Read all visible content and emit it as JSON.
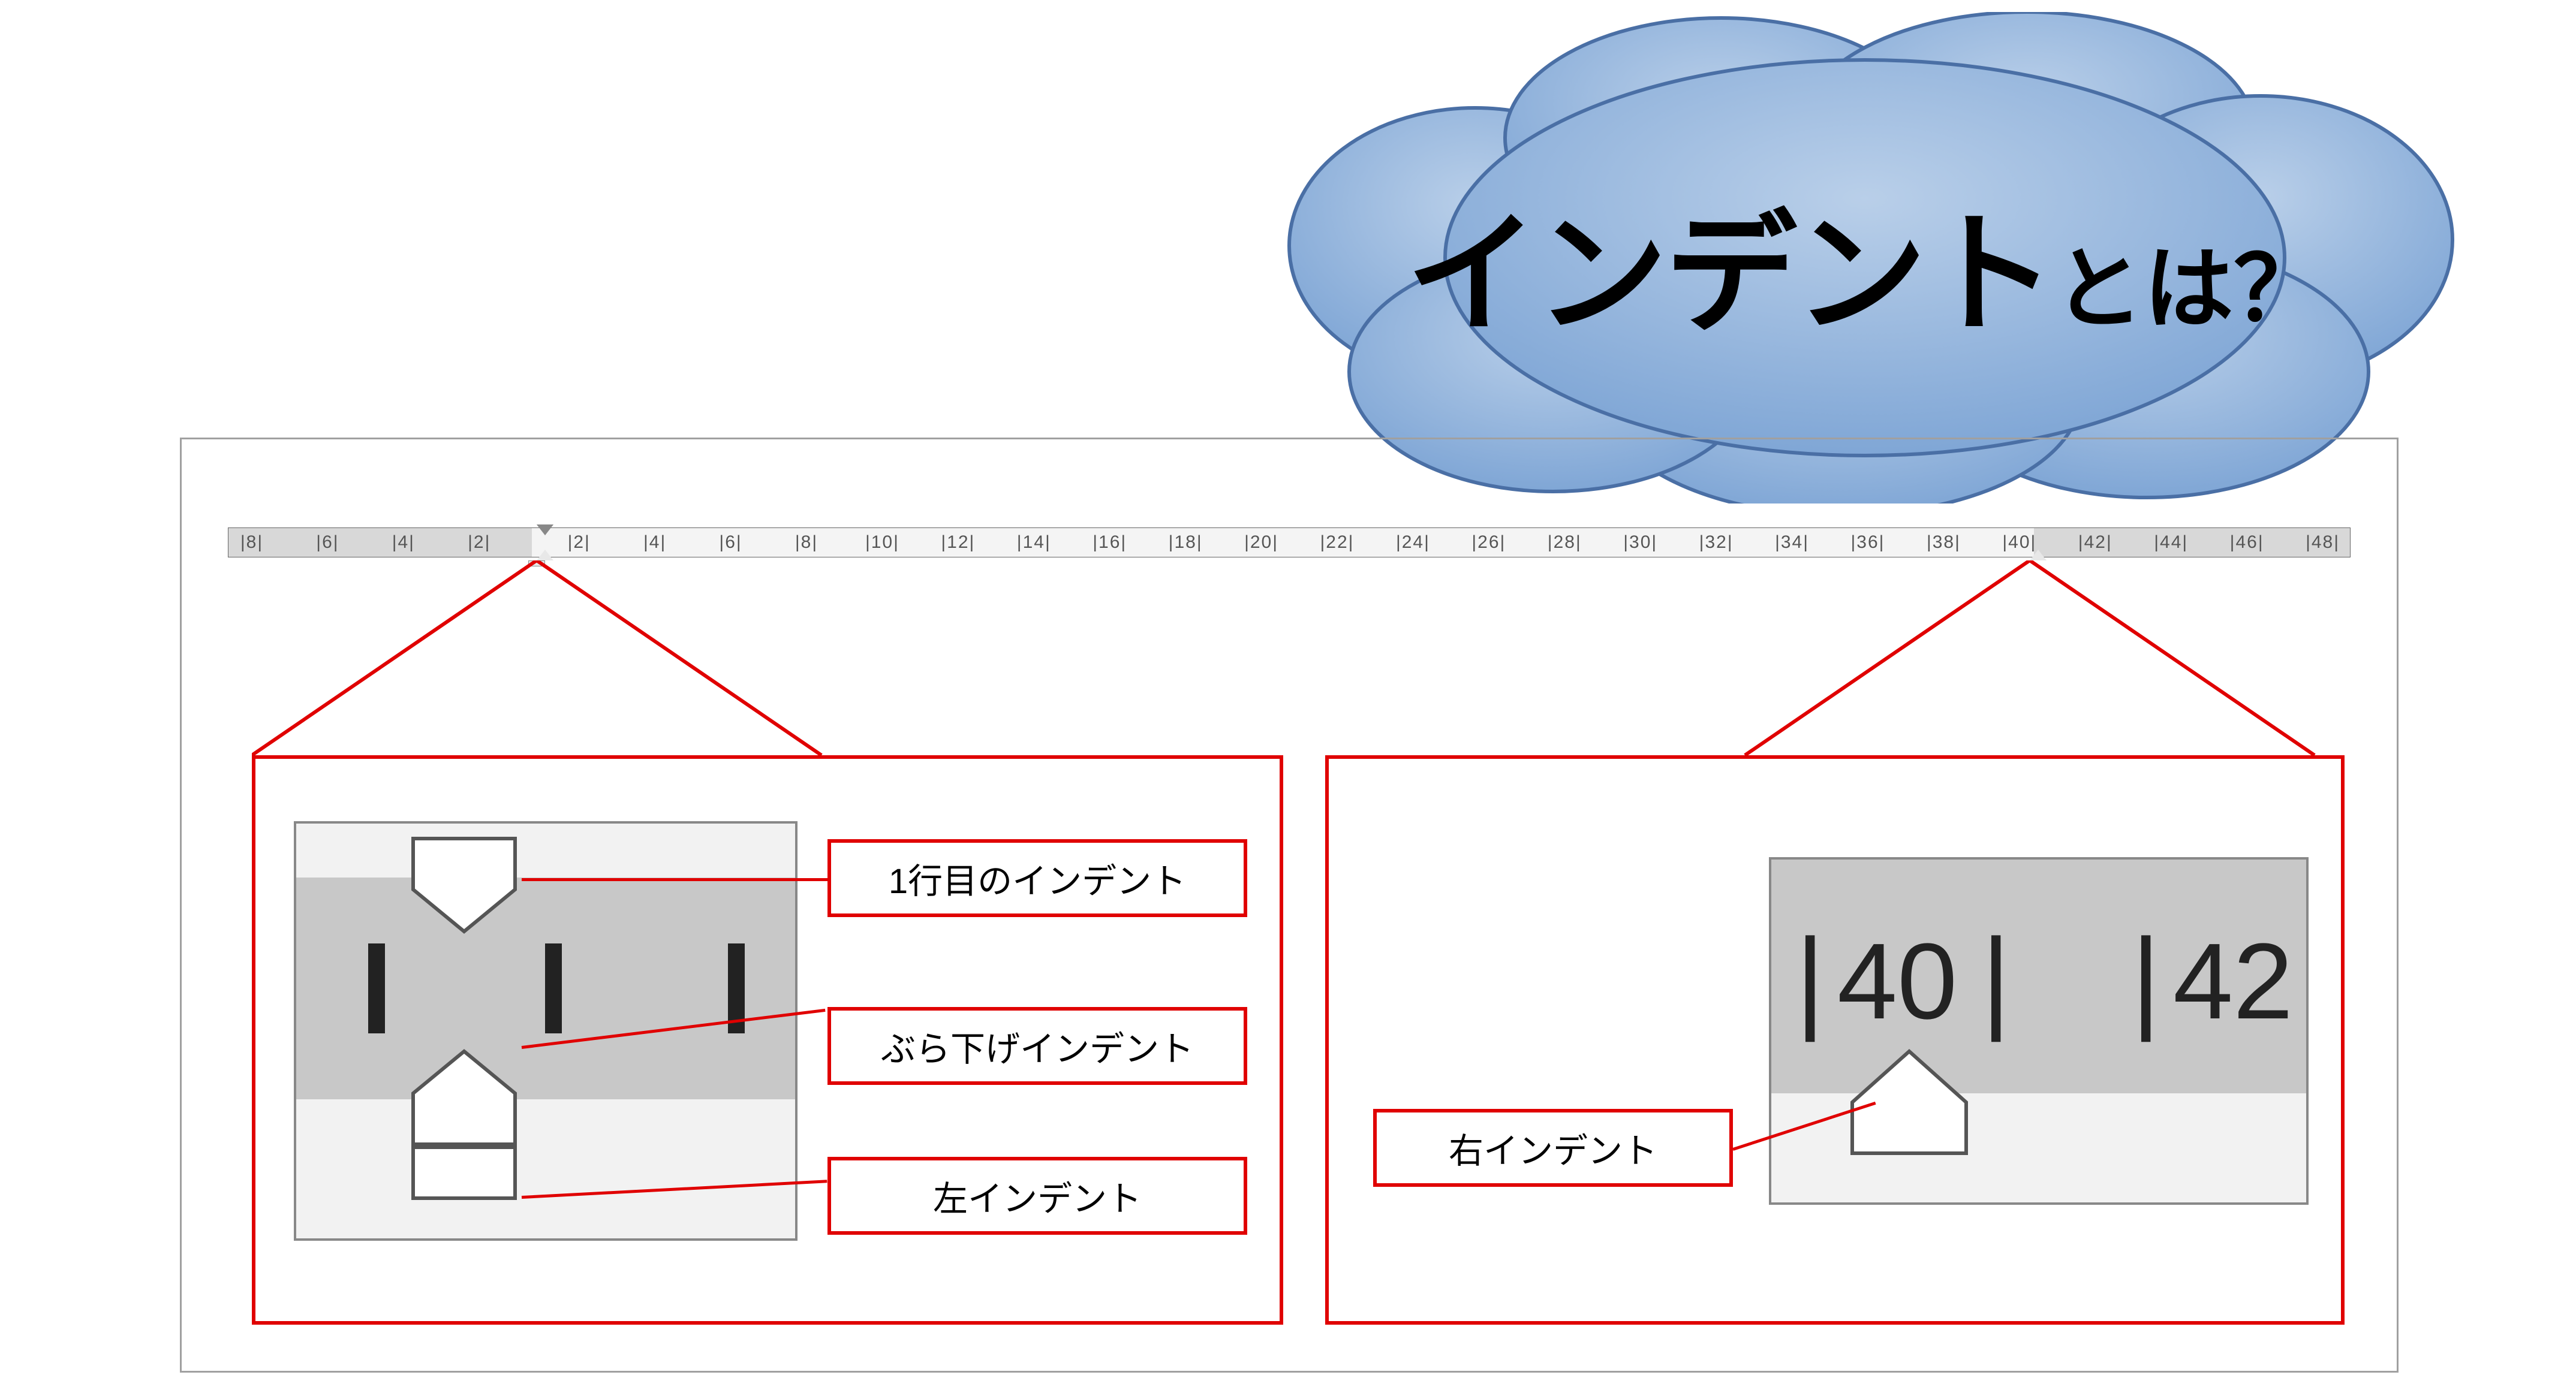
{
  "title": {
    "bold": "インデント",
    "tail": "とは？"
  },
  "ruler_numbers": [
    8,
    6,
    4,
    2,
    2,
    4,
    6,
    8,
    10,
    12,
    14,
    16,
    18,
    20,
    22,
    24,
    26,
    28,
    30,
    32,
    34,
    36,
    38,
    40,
    42,
    44,
    46,
    48
  ],
  "labels": {
    "first_line": "1行目のインデント",
    "hanging": "ぶら下げインデント",
    "left": "左インデント",
    "right": "右インデント"
  },
  "zoom_right": {
    "n1": "40",
    "n2": "42"
  },
  "colors": {
    "accent": "#e00000",
    "cloud": "#8aaede",
    "cloud_edge": "#4a6fa5"
  }
}
